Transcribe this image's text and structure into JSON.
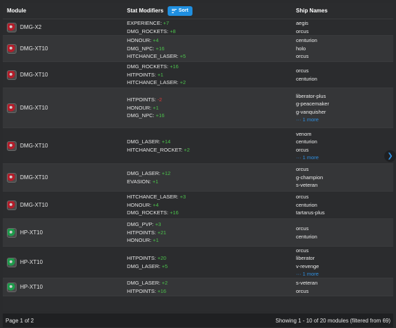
{
  "header": {
    "module": "Module",
    "stat_modifiers": "Stat Modifiers",
    "sort_label": "Sort",
    "ship_names": "Ship Names"
  },
  "rows": [
    {
      "module": "DMG-X2",
      "type": "dmg",
      "stats": [
        {
          "name": "EXPERIENCE:",
          "value": "+7",
          "sign": "pos"
        },
        {
          "name": "DMG_ROCKETS:",
          "value": "+8",
          "sign": "pos"
        }
      ],
      "ships": [
        "aegis",
        "orcus"
      ],
      "more": ""
    },
    {
      "module": "DMG-XT10",
      "type": "dmg",
      "stats": [
        {
          "name": "HONOUR:",
          "value": "+4",
          "sign": "pos"
        },
        {
          "name": "DMG_NPC:",
          "value": "+16",
          "sign": "pos"
        },
        {
          "name": "HITCHANCE_LASER:",
          "value": "+5",
          "sign": "pos"
        }
      ],
      "ships": [
        "centurion",
        "holo",
        "orcus"
      ],
      "more": ""
    },
    {
      "module": "DMG-XT10",
      "type": "dmg",
      "stats": [
        {
          "name": "DMG_ROCKETS:",
          "value": "+16",
          "sign": "pos"
        },
        {
          "name": "HITPOINTS:",
          "value": "+1",
          "sign": "pos"
        },
        {
          "name": "HITCHANCE_LASER:",
          "value": "+2",
          "sign": "pos"
        }
      ],
      "ships": [
        "orcus",
        "centurion"
      ],
      "more": ""
    },
    {
      "module": "DMG-XT10",
      "type": "dmg",
      "stats": [
        {
          "name": "HITPOINTS:",
          "value": "-2",
          "sign": "neg"
        },
        {
          "name": "HONOUR:",
          "value": "+1",
          "sign": "pos"
        },
        {
          "name": "DMG_NPC:",
          "value": "+16",
          "sign": "pos"
        }
      ],
      "ships": [
        "liberator-plus",
        "g-peacemaker",
        "g-vanquisher"
      ],
      "more": "··· 1 more"
    },
    {
      "module": "DMG-XT10",
      "type": "dmg",
      "stats": [
        {
          "name": "DMG_LASER:",
          "value": "+14",
          "sign": "pos"
        },
        {
          "name": "HITCHANCE_ROCKET:",
          "value": "+2",
          "sign": "pos"
        }
      ],
      "ships": [
        "venom",
        "centurion",
        "orcus"
      ],
      "more": "··· 1 more"
    },
    {
      "module": "DMG-XT10",
      "type": "dmg",
      "stats": [
        {
          "name": "DMG_LASER:",
          "value": "+12",
          "sign": "pos"
        },
        {
          "name": "EVASION:",
          "value": "+1",
          "sign": "pos"
        }
      ],
      "ships": [
        "orcus",
        "g-champion",
        "s-veteran"
      ],
      "more": ""
    },
    {
      "module": "DMG-XT10",
      "type": "dmg",
      "stats": [
        {
          "name": "HITCHANCE_LASER:",
          "value": "+3",
          "sign": "pos"
        },
        {
          "name": "HONOUR:",
          "value": "+4",
          "sign": "pos"
        },
        {
          "name": "DMG_ROCKETS:",
          "value": "+16",
          "sign": "pos"
        }
      ],
      "ships": [
        "orcus",
        "centurion",
        "tartarus-plus"
      ],
      "more": ""
    },
    {
      "module": "HP-XT10",
      "type": "hp",
      "stats": [
        {
          "name": "DMG_PVP:",
          "value": "+3",
          "sign": "pos"
        },
        {
          "name": "HITPOINTS:",
          "value": "+21",
          "sign": "pos"
        },
        {
          "name": "HONOUR:",
          "value": "+1",
          "sign": "pos"
        }
      ],
      "ships": [
        "orcus",
        "centurion"
      ],
      "more": ""
    },
    {
      "module": "HP-XT10",
      "type": "hp",
      "stats": [
        {
          "name": "HITPOINTS:",
          "value": "+20",
          "sign": "pos"
        },
        {
          "name": "DMG_LASER:",
          "value": "+5",
          "sign": "pos"
        }
      ],
      "ships": [
        "orcus",
        "liberator",
        "v-revenge"
      ],
      "more": "··· 1 more"
    },
    {
      "module": "HP-XT10",
      "type": "hp",
      "stats": [
        {
          "name": "DMG_LASER:",
          "value": "+2",
          "sign": "pos"
        },
        {
          "name": "HITPOINTS:",
          "value": "+16",
          "sign": "pos"
        }
      ],
      "ships": [
        "s-veteran",
        "orcus"
      ],
      "more": ""
    }
  ],
  "footer": {
    "page": "Page 1 of 2",
    "summary": "Showing 1 - 10 of 20 modules (filtered from 69)"
  },
  "icons": {
    "sort": "sort-lines-icon",
    "next": "chevron-right-icon",
    "module_dmg": "dmg-module-icon",
    "module_hp": "hp-module-icon"
  },
  "colors": {
    "accent": "#1f8fe0",
    "positive": "#4cc24c",
    "negative": "#e23b3b",
    "link": "#2e8fe0"
  }
}
